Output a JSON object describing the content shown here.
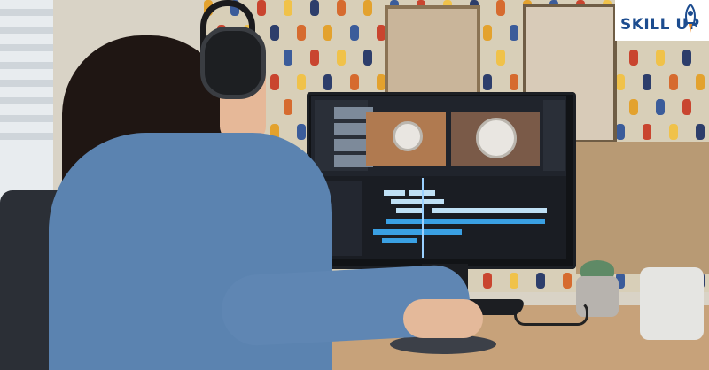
{
  "logo": {
    "text": "SKILL UP",
    "color": "#1c4c8f",
    "icon": "rocket-icon"
  },
  "colors": {
    "shirt": "#5b83b0",
    "timeline_clip_blue": "#3aa0e3",
    "wall": "#d9d3c6"
  }
}
